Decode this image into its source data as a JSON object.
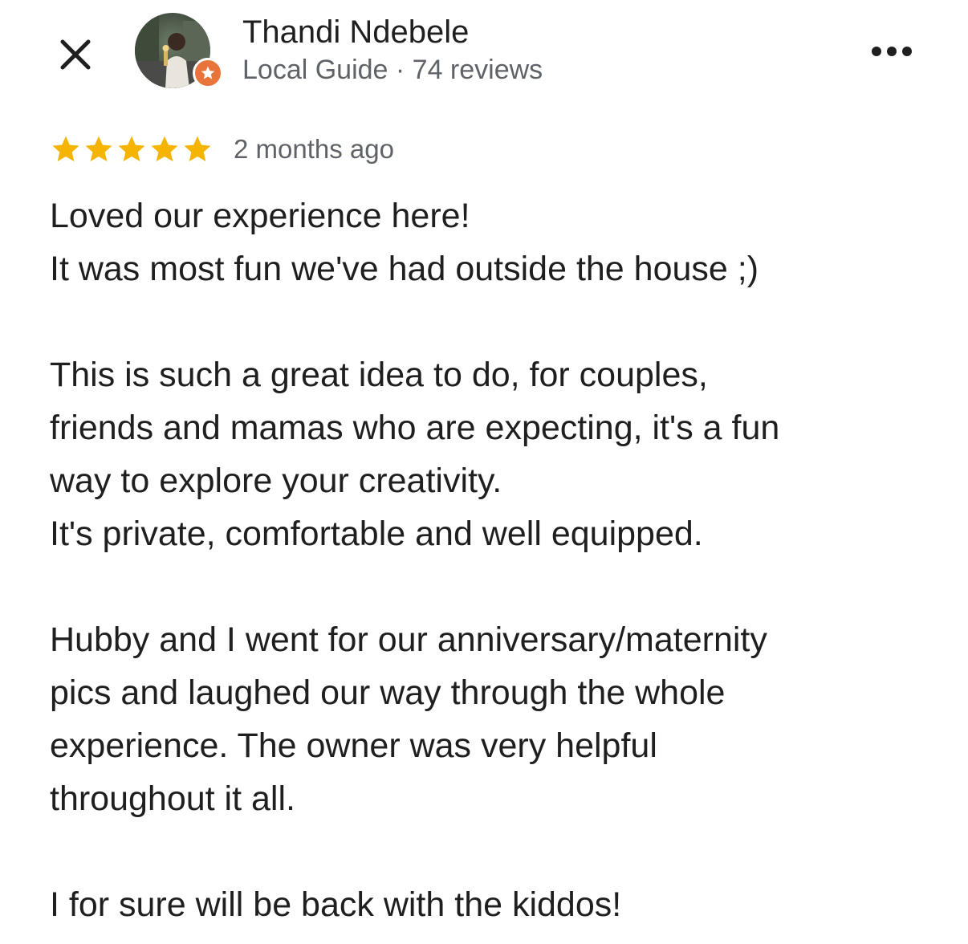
{
  "header": {
    "close_icon": "close-icon",
    "more_icon": "more-horizontal-icon",
    "badge_icon": "local-guide-star-icon"
  },
  "reviewer": {
    "name": "Thandi Ndebele",
    "meta": "Local Guide · 74 reviews"
  },
  "review": {
    "rating": 5,
    "rating_max": 5,
    "star_color": "#f5b400",
    "date": "2 months ago",
    "lines": [
      "Loved our experience here!",
      "It was most fun we've had outside the house ;)",
      "",
      "This is such a great idea to do, for couples,",
      "friends and mamas who are expecting, it's a fun",
      "way to explore your creativity.",
      "It's private, comfortable and well equipped.",
      "",
      "Hubby and I went for our anniversary/maternity",
      "pics and laughed our way through the whole",
      "experience. The owner was very helpful",
      "throughout it all.",
      "",
      "I for sure will be back with the kiddos!"
    ]
  },
  "colors": {
    "text_primary": "#1f1f1f",
    "text_secondary": "#5f6368",
    "badge": "#e8743b"
  }
}
